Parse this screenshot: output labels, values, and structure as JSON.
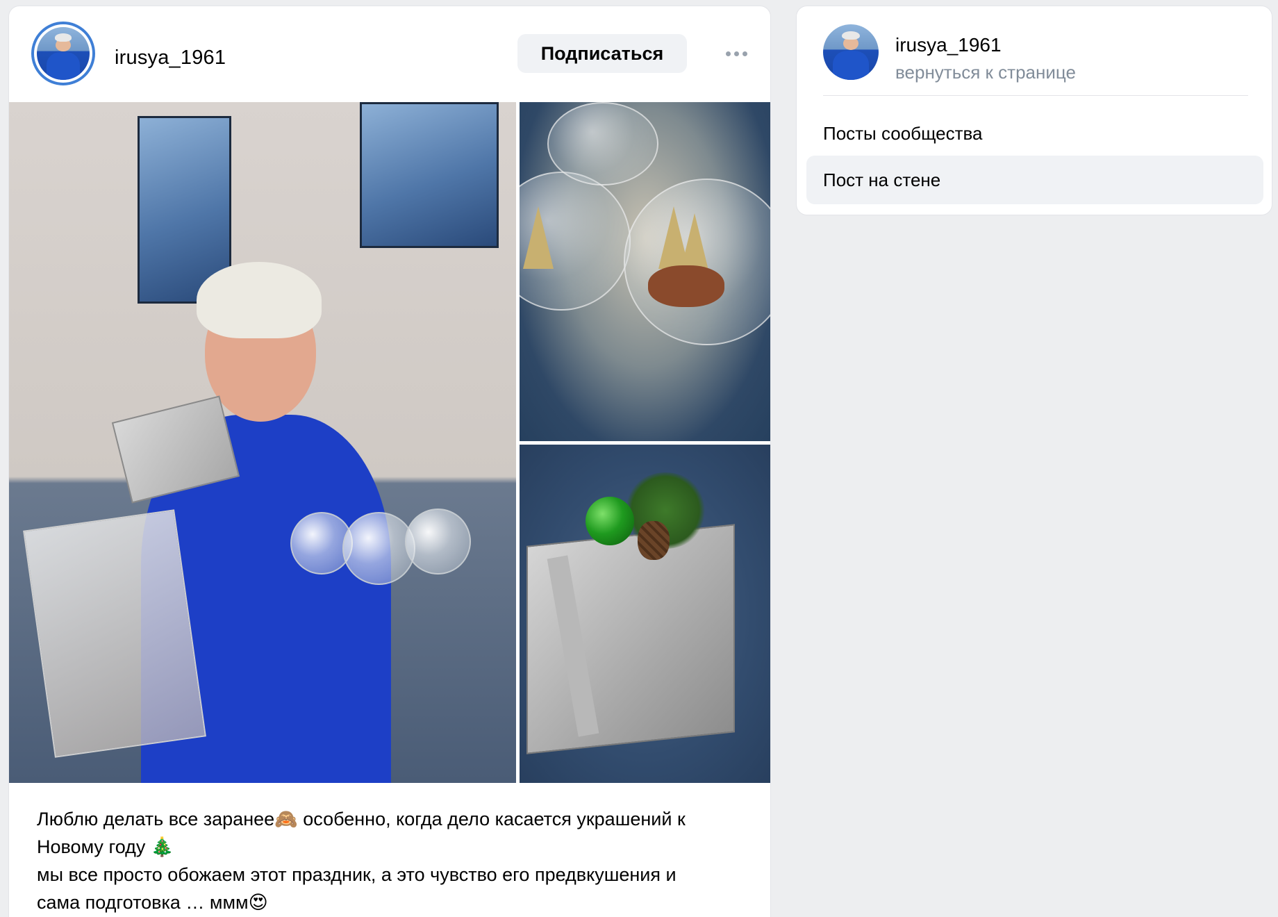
{
  "post": {
    "author": "irusya_1961",
    "subscribe_label": "Подписаться",
    "more_label": "•••",
    "text_lines": [
      "Люблю делать все заранее🙈 особенно, когда дело касается украшений к",
      "Новому году 🎄",
      "мы все просто обожаем этот праздник, а это чувство его предвкушения и",
      "сама подготовка … ммм😍"
    ],
    "photos": [
      {
        "subject": "woman in blue top holding silver gift box and glass christmas ornaments"
      },
      {
        "subject": "glass ball ornaments with tiny trees, deer and squirrel figurines"
      },
      {
        "subject": "silver wrapped gift box with green bauble, pinecone and pine sprig"
      }
    ]
  },
  "sidebar": {
    "name": "irusya_1961",
    "back_link": "вернуться к странице",
    "items": [
      {
        "label": "Посты сообщества",
        "selected": false
      },
      {
        "label": "Пост на стене",
        "selected": true
      }
    ]
  },
  "colors": {
    "page_bg": "#edeef0",
    "card_bg": "#ffffff",
    "avatar_ring": "#3f7fd6",
    "secondary_text": "#818c99",
    "button_bg": "#f0f2f5"
  }
}
